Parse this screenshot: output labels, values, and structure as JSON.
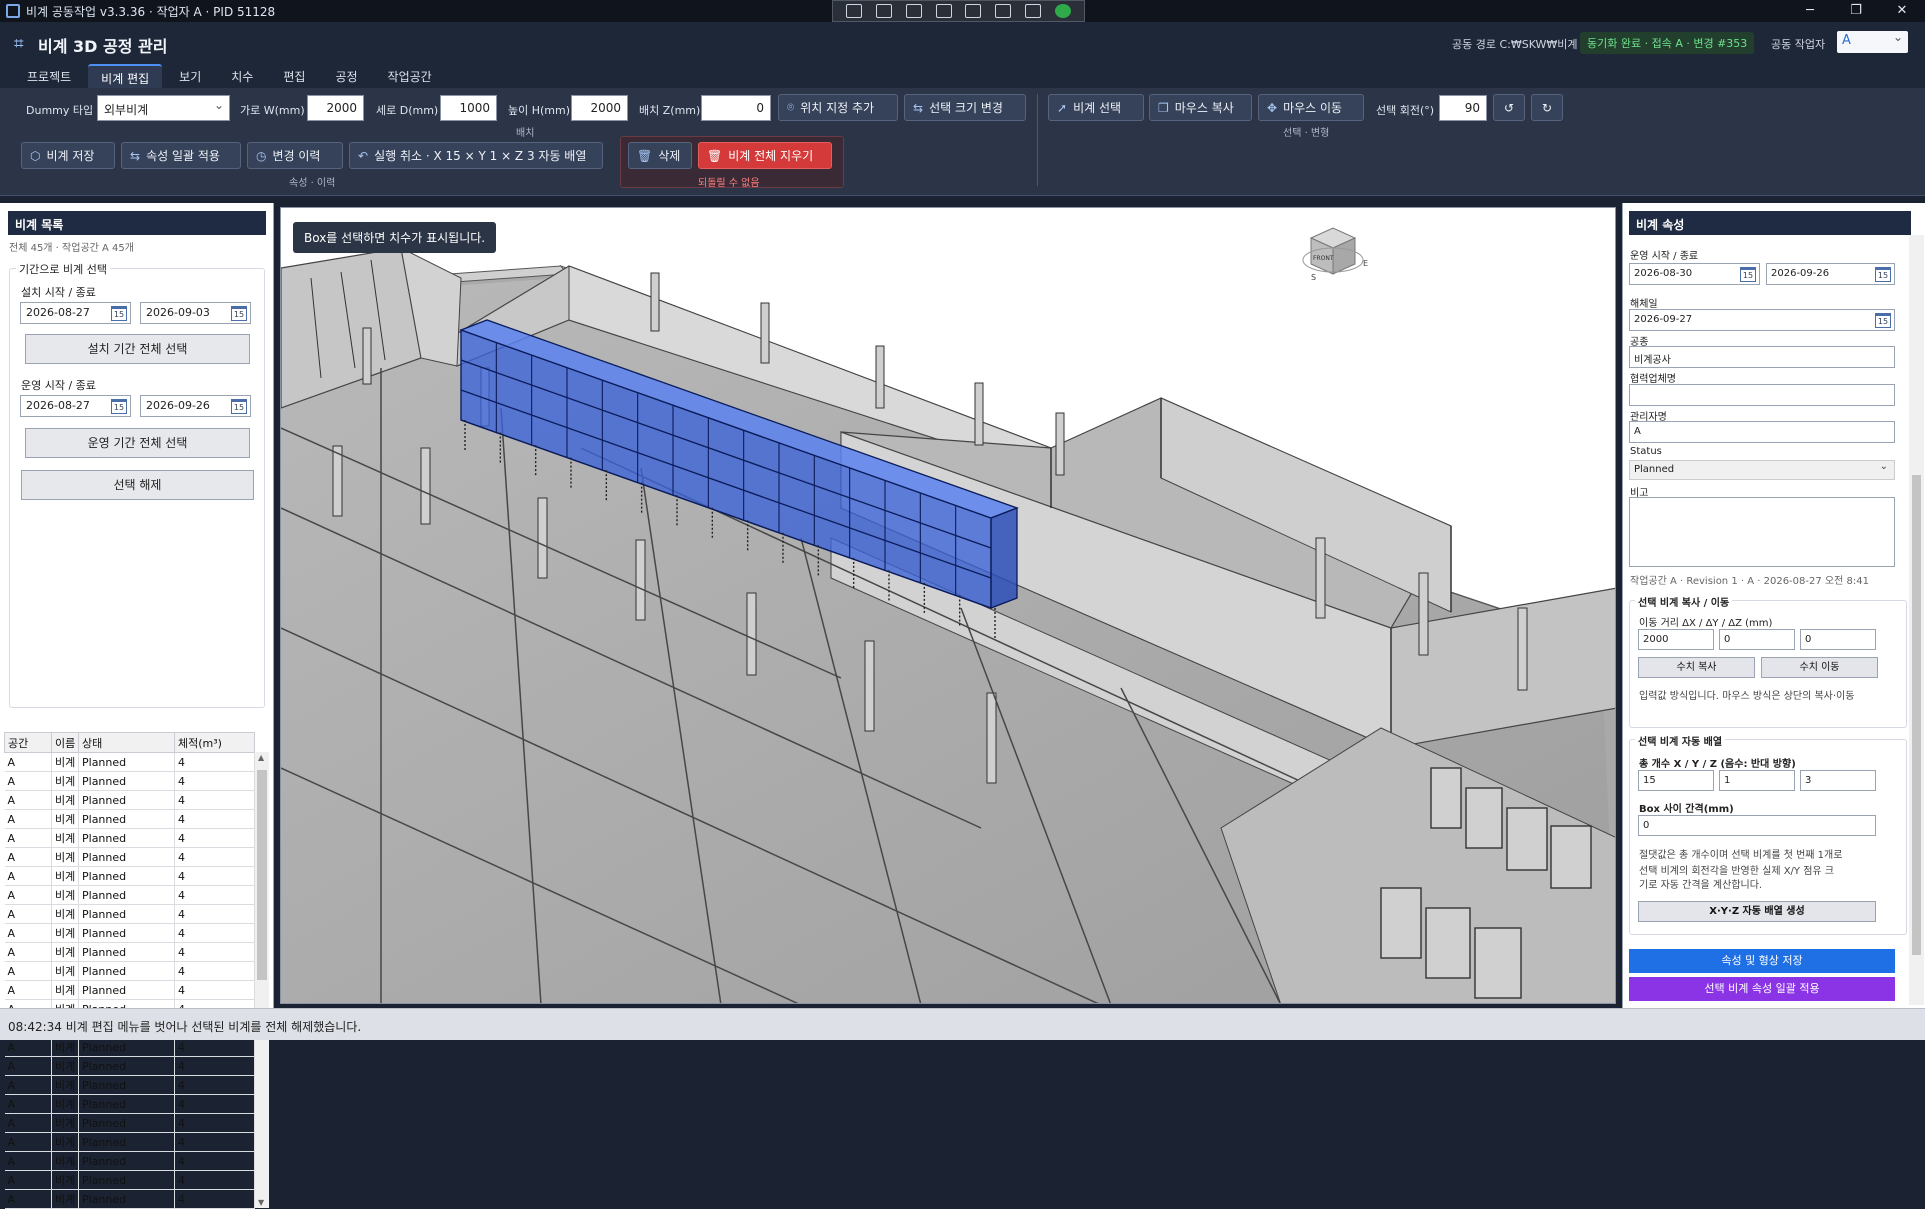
{
  "window": {
    "title": "비계 공동작업 v3.3.36 · 작업자 A · PID 51128",
    "controls": {
      "minimize": "─",
      "maximize": "❐",
      "close": "✕"
    }
  },
  "header": {
    "title": "비계 3D 공정 관리",
    "shared_path": "공동 경로 C:₩SKW₩비계",
    "sync_status": "동기화 완료 · 접속 A · 변경 #353",
    "worker_label": "공동 작업자",
    "worker_value": "A"
  },
  "tabs": [
    "프로젝트",
    "비계 편집",
    "보기",
    "치수",
    "편집",
    "공정",
    "작업공간"
  ],
  "active_tab_index": 1,
  "ribbon": {
    "dummy_type_label": "Dummy 타입",
    "dummy_type_value": "외부비계",
    "width_label": "가로 W(mm)",
    "width_value": "2000",
    "depth_label": "세로 D(mm)",
    "depth_value": "1000",
    "height_label": "높이 H(mm)",
    "height_value": "2000",
    "z_label": "배치 Z(mm)",
    "z_value": "0",
    "add_position": "위치 지정 추가",
    "resize_selected": "선택 크기 변경",
    "group_placement": "배치",
    "select_scaffold": "비계 선택",
    "mouse_copy": "마우스 복사",
    "mouse_move": "마우스 이동",
    "rotate_label": "선택 회전(°)",
    "rotate_value": "90",
    "group_select_transform": "선택 · 변형",
    "save_scaffold": "비계 저장",
    "apply_props": "속성 일괄 적용",
    "change_history": "변경 이력",
    "undo": "실행 취소 · X 15 × Y 1 × Z 3 자동 배열",
    "group_props_history": "속성 · 이력",
    "delete": "삭제",
    "clear_all": "비계 전체 지우기",
    "group_irreversible": "되돌릴 수 없음"
  },
  "left_panel": {
    "title": "비계 목록",
    "summary": "전체 45개 · 작업공간 A 45개",
    "period_group": "기간으로 비계 선택",
    "install_label": "설치 시작 / 종료",
    "install_start": "2026-08-27",
    "install_end": "2026-09-03",
    "install_select_btn": "설치 기간 전체 선택",
    "operate_label": "운영 시작 / 종료",
    "operate_start": "2026-08-27",
    "operate_end": "2026-09-26",
    "operate_select_btn": "운영 기간 전체 선택",
    "clear_btn": "선택 해제",
    "calendar_glyph": "15",
    "columns": [
      "공간",
      "이름",
      "상태",
      "체적(m³)"
    ],
    "rows": [
      [
        "A",
        "비계",
        "Planned",
        "4"
      ],
      [
        "A",
        "비계",
        "Planned",
        "4"
      ],
      [
        "A",
        "비계",
        "Planned",
        "4"
      ],
      [
        "A",
        "비계",
        "Planned",
        "4"
      ],
      [
        "A",
        "비계",
        "Planned",
        "4"
      ],
      [
        "A",
        "비계",
        "Planned",
        "4"
      ],
      [
        "A",
        "비계",
        "Planned",
        "4"
      ],
      [
        "A",
        "비계",
        "Planned",
        "4"
      ],
      [
        "A",
        "비계",
        "Planned",
        "4"
      ],
      [
        "A",
        "비계",
        "Planned",
        "4"
      ],
      [
        "A",
        "비계",
        "Planned",
        "4"
      ],
      [
        "A",
        "비계",
        "Planned",
        "4"
      ],
      [
        "A",
        "비계",
        "Planned",
        "4"
      ],
      [
        "A",
        "비계",
        "Planned",
        "4"
      ],
      [
        "A",
        "비계",
        "Planned",
        "4"
      ],
      [
        "A",
        "비계",
        "Planned",
        "4"
      ],
      [
        "A",
        "비계",
        "Planned",
        "4"
      ],
      [
        "A",
        "비계",
        "Planned",
        "4"
      ],
      [
        "A",
        "비계",
        "Planned",
        "4"
      ],
      [
        "A",
        "비계",
        "Planned",
        "4"
      ],
      [
        "A",
        "비계",
        "Planned",
        "4"
      ],
      [
        "A",
        "비계",
        "Planned",
        "4"
      ],
      [
        "A",
        "비계",
        "Planned",
        "4"
      ],
      [
        "A",
        "비계",
        "Planned",
        "4"
      ]
    ]
  },
  "viewport": {
    "hint": "Box를 선택하면 치수가 표시됩니다.",
    "view_cube_label": "FRONT",
    "compass": [
      "S",
      "E"
    ]
  },
  "right_panel": {
    "title": "비계 속성",
    "operate_label": "운영 시작 / 종료",
    "operate_start": "2026-08-30",
    "operate_end": "2026-09-26",
    "dismantle_label": "해체일",
    "dismantle_value": "2026-09-27",
    "trade_label": "공종",
    "trade_value": "비계공사",
    "partner_label": "협력업체명",
    "partner_value": "",
    "manager_label": "관리자명",
    "manager_value": "A",
    "status_label": "Status",
    "status_value": "Planned",
    "note_label": "비고",
    "meta": "작업공간 A · Revision 1 · A · 2026-08-27 오전 8:41",
    "copy_move_group": "선택 비계 복사 / 이동",
    "move_dist_label": "이동 거리 ΔX / ΔY / ΔZ (mm)",
    "dx": "2000",
    "dy": "0",
    "dz": "0",
    "num_copy": "수치 복사",
    "num_move": "수치 이동",
    "copy_note": "입력값 방식입니다. 마우스 방식은 상단의 복사·이동",
    "auto_array_group": "선택 비계 자동 배열",
    "count_label": "총 개수 X / Y / Z (음수: 반대 방향)",
    "cx": "15",
    "cy": "1",
    "cz": "3",
    "gap_label": "Box 사이 간격(mm)",
    "gap_value": "0",
    "array_note1": "절댓값은 총 개수이며 선택 비계를 첫 번째 1개로",
    "array_note2": "선택 비계의 회전각을 반영한 실제 X/Y 점유 크",
    "array_note3": "기로 자동 간격을 계산합니다.",
    "array_btn": "X·Y·Z 자동 배열 생성",
    "save_btn": "속성 및 형상 저장",
    "apply_btn": "선택 비계 속성 일괄 적용"
  },
  "status_bar": "08:42:34  비계 편집 메뉴를 벗어나 선택된 비계를 전체 해제했습니다.",
  "colors": {
    "accent_blue": "#1f6fe5",
    "danger_red": "#d43a3a",
    "purple": "#8a34e6",
    "sync_green": "#6fe08c",
    "scaffold_blue": "#3a63d8"
  },
  "icons": [
    "app-icon",
    "pin-icon",
    "resize-icon",
    "cursor-icon",
    "copy-icon",
    "move-icon",
    "rotate-left-icon",
    "rotate-right-icon",
    "cube-icon",
    "sliders-icon",
    "history-icon",
    "undo-icon",
    "trash-icon",
    "calendar-icon",
    "view-cube"
  ]
}
